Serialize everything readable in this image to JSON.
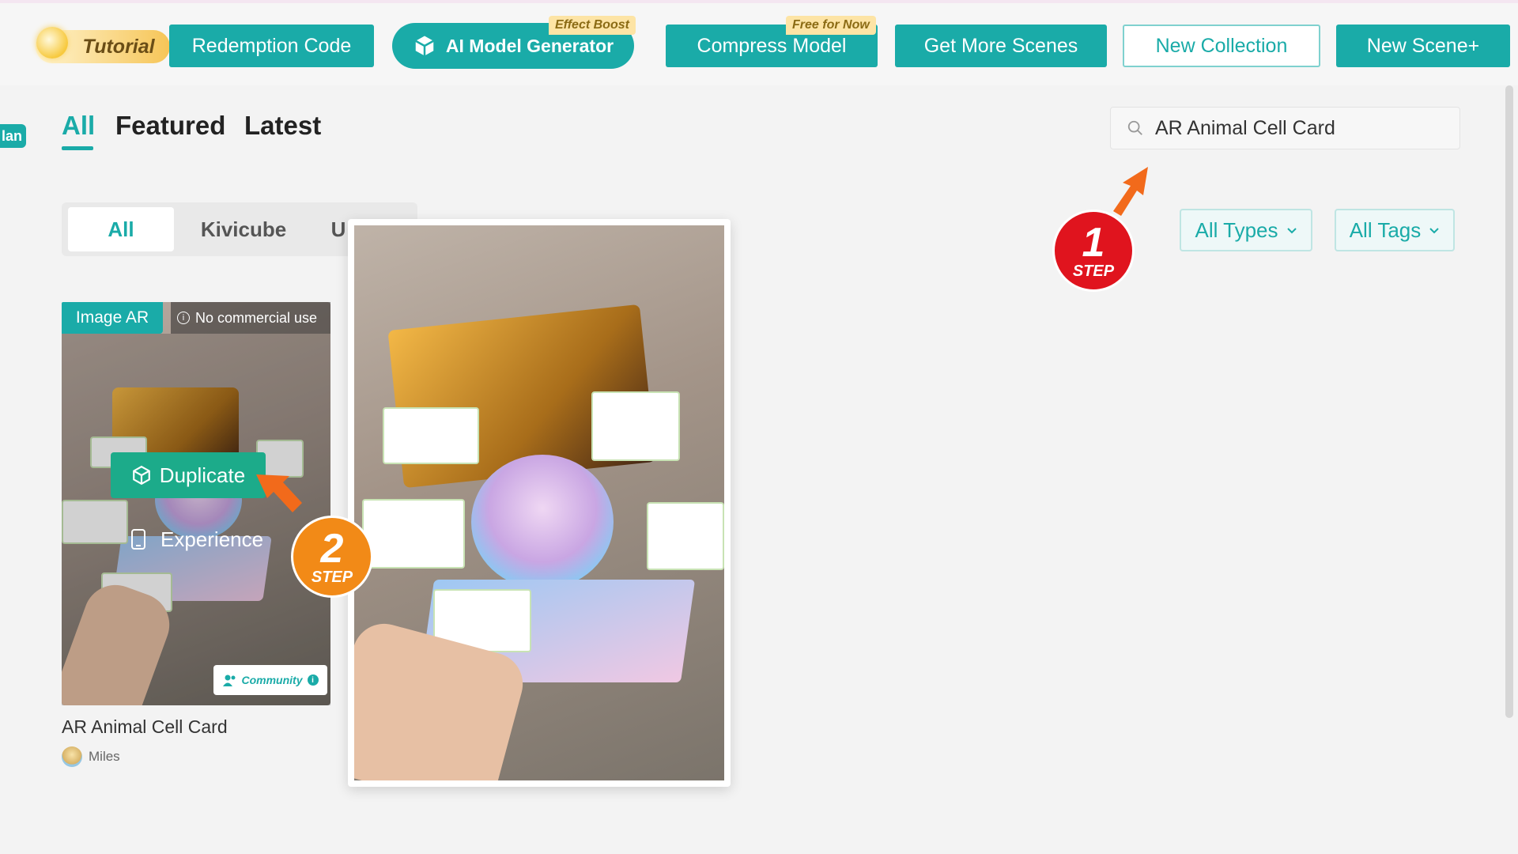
{
  "header": {
    "tutorial": "Tutorial",
    "buttons": {
      "redemption": "Redemption Code",
      "ai_model": "AI Model Generator",
      "ai_model_badge": "Effect Boost",
      "compress": "Compress Model",
      "compress_badge": "Free for Now",
      "get_scenes": "Get More Scenes",
      "new_collection": "New Collection",
      "new_scene": "New Scene+"
    }
  },
  "left_tag": "lan",
  "tabs": [
    "All",
    "Featured",
    "Latest"
  ],
  "search": {
    "value": "AR Animal Cell Card"
  },
  "filters": {
    "types": "All Types",
    "tags": "All Tags"
  },
  "segments": [
    "All",
    "Kivicube",
    "U"
  ],
  "card": {
    "type_badge": "Image AR",
    "license": "No commercial use",
    "duplicate": "Duplicate",
    "experience": "Experience",
    "community": "Community",
    "title": "AR Animal Cell Card",
    "author": "Miles"
  },
  "steps": [
    {
      "num": "1",
      "label": "STEP"
    },
    {
      "num": "2",
      "label": "STEP"
    }
  ],
  "colors": {
    "accent": "#1aaba8",
    "step1": "#e0141e",
    "step2": "#f28a17",
    "arrow": "#f26a1b"
  }
}
